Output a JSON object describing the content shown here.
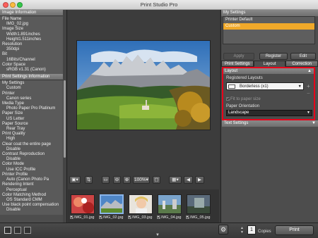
{
  "window": {
    "title": "Print Studio Pro"
  },
  "left_panel": {
    "image_info": {
      "header": "Image Information",
      "rows": [
        {
          "label": "File Name",
          "value": "IMG_02.jpg"
        },
        {
          "label": "Image Size",
          "value": "Width1.891inches"
        },
        {
          "label": "",
          "value": "Height1.511inches"
        },
        {
          "label": "Resolution",
          "value": "350dpi"
        },
        {
          "label": "Bit",
          "value": "16Bits/Channel"
        },
        {
          "label": "Color Space",
          "value": "sRGB v1.31 (Canon)"
        }
      ]
    },
    "print_settings": {
      "header": "Print Settings Information",
      "rows": [
        {
          "label": "My Settings",
          "value": "Custom"
        },
        {
          "label": "Printer",
          "value": "Canon                series"
        },
        {
          "label": "Media Type",
          "value": "Photo Paper Pro Platinum"
        },
        {
          "label": "Paper Size",
          "value": "US Letter"
        },
        {
          "label": "Paper Source",
          "value": "Rear Tray"
        },
        {
          "label": "Print Quality",
          "value": "High"
        },
        {
          "label": "Clear coat the entire page",
          "value": "Disable"
        },
        {
          "label": "Contrast Reproduction",
          "value": "Disable"
        },
        {
          "label": "Color Mode",
          "value": "Use ICC Profile"
        },
        {
          "label": "Printer Profile",
          "value": "Auto (Canon                Photo Pa"
        },
        {
          "label": "Rendering Intent",
          "value": "Perceptual"
        },
        {
          "label": "Color Matching Method",
          "value": "OS Standard CMM"
        },
        {
          "label": "Use black point compensation",
          "value": "Disable"
        }
      ]
    }
  },
  "toolbar": {
    "zoom": "100%"
  },
  "thumbnails": [
    {
      "caption": "IMG_01.jpg",
      "selected": false
    },
    {
      "caption": "IMG_02.jpg",
      "selected": true
    },
    {
      "caption": "IMG_03.jpg",
      "selected": false
    },
    {
      "caption": "IMG_04.jpg",
      "selected": false
    },
    {
      "caption": "IMG_05.jpg",
      "selected": false
    }
  ],
  "right_panel": {
    "my_settings": {
      "header": "My Settings",
      "items": [
        "Printer Default",
        "Custom"
      ],
      "selected": "Custom"
    },
    "buttons": {
      "apply": "Apply",
      "register": "Register",
      "edit": "Edit"
    },
    "tabs": [
      "Print Settings",
      "Layout",
      "Correction"
    ],
    "active_tab": "Layout",
    "layout": {
      "header": "Layout",
      "registered_layouts_label": "Registered Layouts",
      "registered_layout_value": "Borderless (x1)",
      "fit_to_paper": "Fit to paper size",
      "paper_orientation_label": "Paper Orientation",
      "paper_orientation_value": "Landscape"
    },
    "text_settings": "Text Settings"
  },
  "bottom": {
    "copies_value": "1",
    "copies_label": "Copies",
    "print_label": "Print"
  },
  "colors": {
    "accent": "#f0a92a",
    "highlight_box": "#e8001a"
  }
}
